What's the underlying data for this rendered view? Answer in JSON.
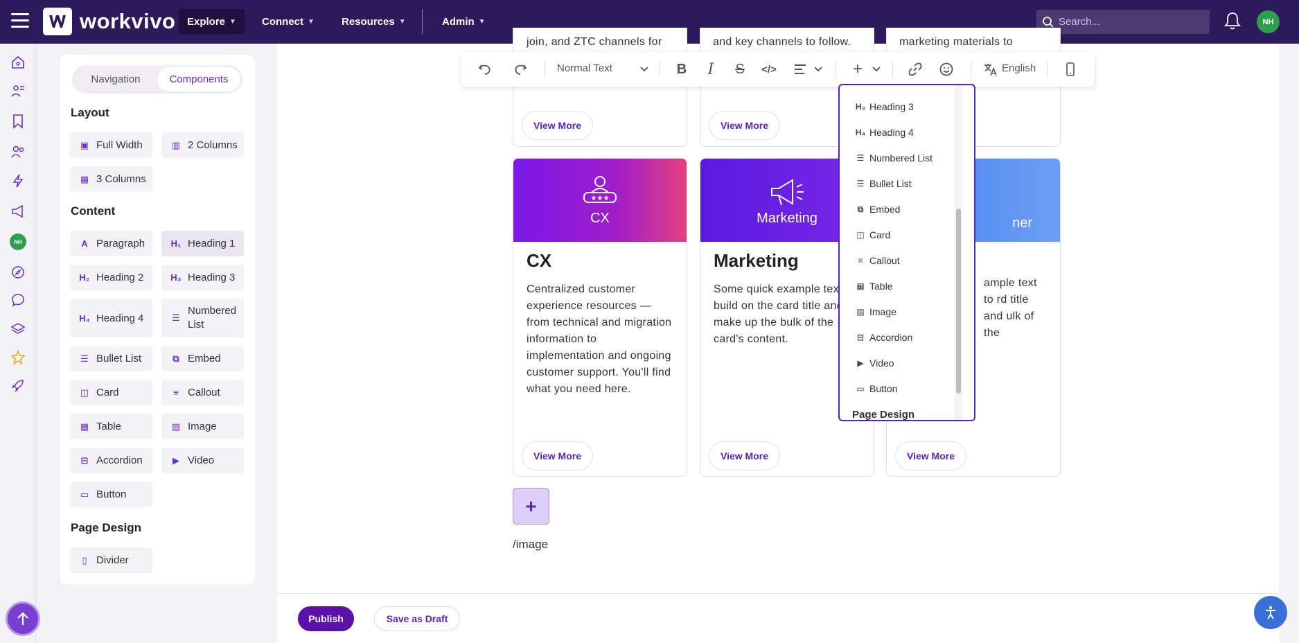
{
  "topbar": {
    "brand": "workvivo",
    "nav": [
      {
        "label": "Explore"
      },
      {
        "label": "Connect"
      },
      {
        "label": "Resources"
      },
      {
        "label": "Admin"
      }
    ],
    "search_placeholder": "Search...",
    "avatar_initials": "NH"
  },
  "rail": {
    "avatar_initials": "NH"
  },
  "panel": {
    "tabs": [
      "Navigation",
      "Components"
    ],
    "active_tab": "Components",
    "layout_title": "Layout",
    "layout_items": [
      "Full Width",
      "2 Columns",
      "3 Columns"
    ],
    "content_title": "Content",
    "content_items": [
      "Paragraph",
      "Heading 1",
      "Heading 2",
      "Heading 3",
      "Heading 4",
      "Numbered List",
      "Bullet List",
      "Embed",
      "Card",
      "Callout",
      "Table",
      "Image",
      "Accordion",
      "Video",
      "Button"
    ],
    "page_design_title": "Page Design",
    "page_design_items": [
      "Divider"
    ]
  },
  "toolbar": {
    "text_style": "Normal Text",
    "language": "English"
  },
  "dropdown": {
    "items": [
      "Heading 3",
      "Heading 4",
      "Numbered List",
      "Bullet List",
      "Embed",
      "Card",
      "Callout",
      "Table",
      "Image",
      "Accordion",
      "Video",
      "Button"
    ],
    "section": "Page Design"
  },
  "cards_top": {
    "text1": "join, and ZTC channels for",
    "text2": "and key channels to follow.",
    "text3": "marketing materials to",
    "view_more": "View More"
  },
  "cards": [
    {
      "banner_label": "CX",
      "title": "CX",
      "body": "Centralized customer experience resources — from technical and migration information to implementation and ongoing customer support. You'll find what you need here.",
      "view_more": "View More",
      "color": "#8a1fd8"
    },
    {
      "banner_label": "Marketing",
      "title": "Marketing",
      "body": "Some quick example text to build on the card title and make up the bulk of the card's content.",
      "view_more": "View More",
      "color": "#6b1ee0"
    },
    {
      "banner_label": "ner",
      "title": "",
      "body": "ample text to rd title and ulk of the",
      "view_more": "View More",
      "color": "#5d8cf0"
    }
  ],
  "editor": {
    "slash_text": "/image"
  },
  "footer": {
    "publish": "Publish",
    "save_draft": "Save as Draft"
  },
  "colors": {
    "topbar": "#2d1a5a",
    "accent": "#5a11a8"
  }
}
